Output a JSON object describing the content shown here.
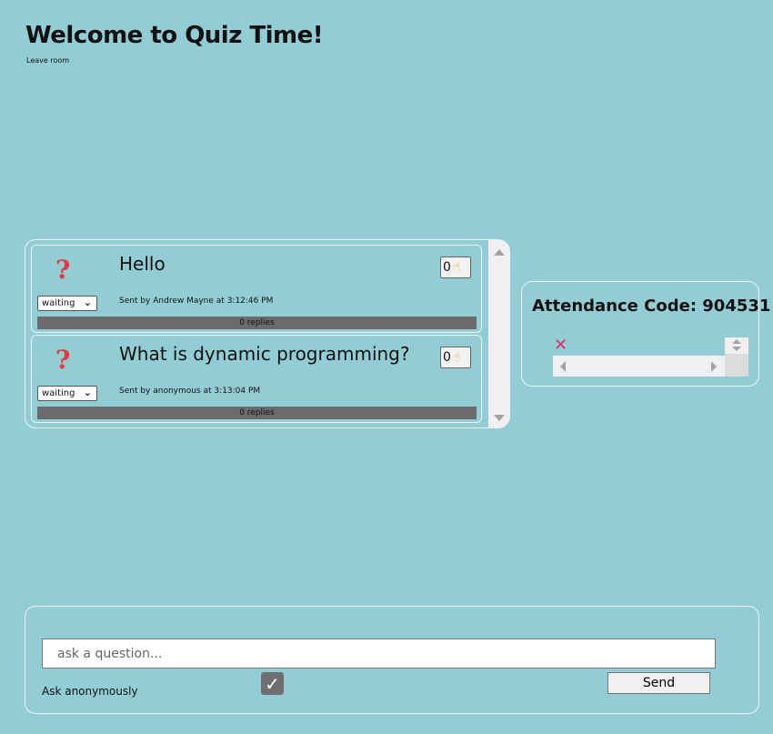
{
  "header": {
    "title": "Welcome to Quiz Time!",
    "leave_label": "Leave room"
  },
  "questions": [
    {
      "icon": "question-mark-icon",
      "text": "Hello",
      "upvotes": "0",
      "status": "waiting",
      "sent_by": "Sent by Andrew Mayne at 3:12:46 PM",
      "replies": "0 replies"
    },
    {
      "icon": "question-mark-icon",
      "text": "What is dynamic programming?",
      "upvotes": "0",
      "status": "waiting",
      "sent_by": "Sent by anonymous at 3:13:04 PM",
      "replies": "0 replies"
    }
  ],
  "attendance": {
    "title": "Attendance Code: 904531",
    "close_icon": "close-icon"
  },
  "composer": {
    "placeholder": "ask a question...",
    "anon_label": "Ask anonymously",
    "anon_checked": true,
    "send_label": "Send"
  },
  "colors": {
    "background": "#92cdd6",
    "question_mark": "#e8383b",
    "close_x": "#e32b5f",
    "reply_bar": "#6b6b6b"
  }
}
